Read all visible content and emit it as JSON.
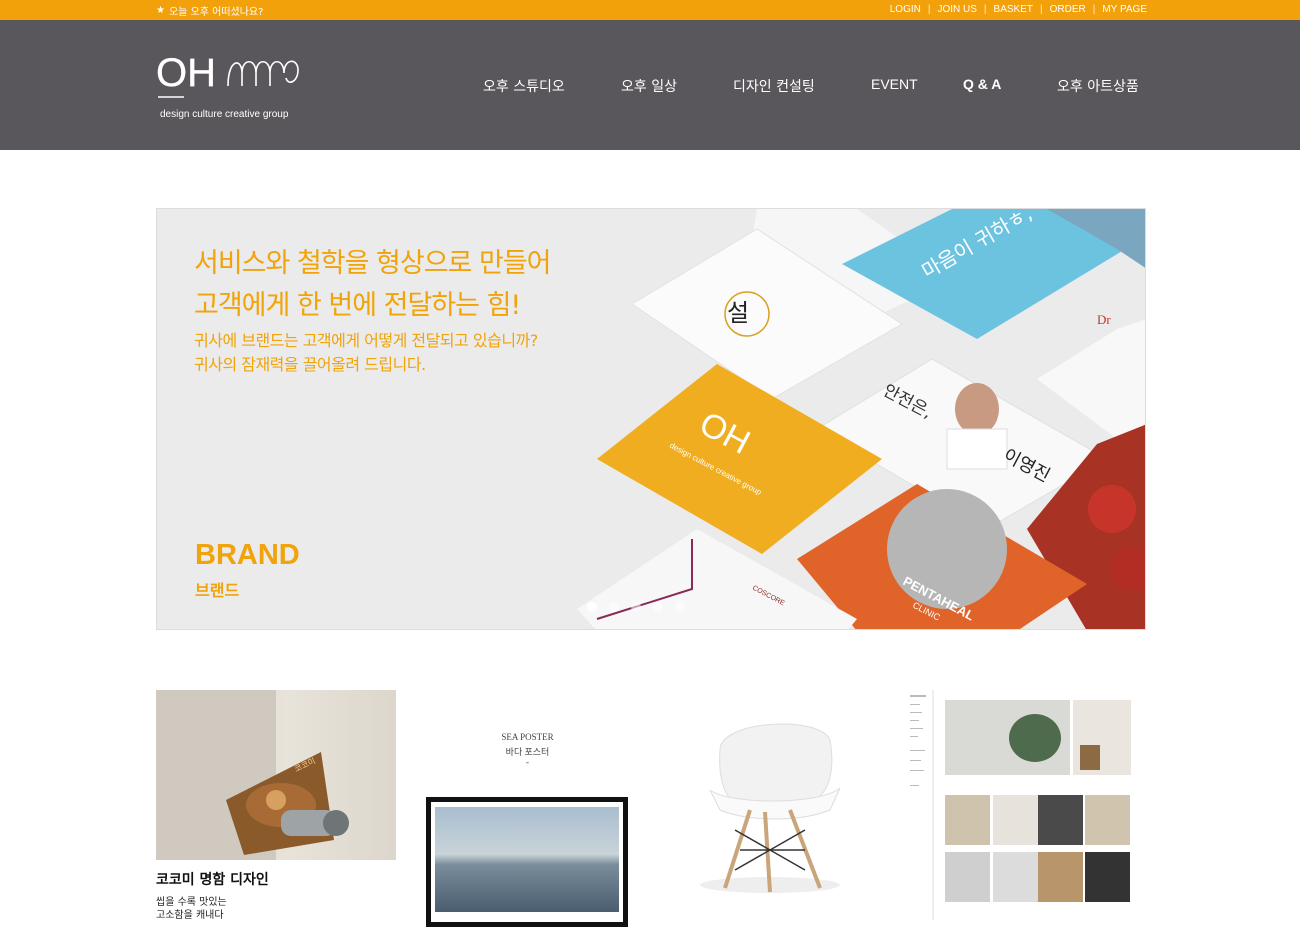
{
  "topbar": {
    "greeting": "오늘 오후 어떠셨나요?",
    "links": [
      "LOGIN",
      "JOIN US",
      "BASKET",
      "ORDER",
      "MY PAGE"
    ]
  },
  "logo": {
    "mark": "OH",
    "subtitle": "design culture creative group"
  },
  "nav": {
    "items": [
      "오후 스튜디오",
      "오후 일상",
      "디자인 컨설팅",
      "EVENT",
      "Q & A",
      "오후 아트상품"
    ]
  },
  "banner": {
    "headline_1": "서비스와 철학을 형상으로 만들어",
    "headline_2": "고객에게 한 번에 전달하는 힘!",
    "sub_1": "귀사에 브랜드는 고객에게 어떻게 전달되고 있습니까?",
    "sub_2": "귀사의 잠재력을 끌어올려 드립니다.",
    "category_en": "BRAND",
    "category_ko": "브랜드",
    "card_texts": {
      "logo_card_mark": "OH",
      "logo_card_sub": "design culture creative group",
      "name_card_top": "안전은,",
      "name_card_name": "이영진",
      "blue_card_text": "마음이 귀하ㅎ,",
      "pentaheal": "PENTAHEAL",
      "clinic": "CLINIC",
      "cosmos": "COSCORE"
    },
    "slides": {
      "count": 5,
      "active_index": 0
    },
    "colors": {
      "accent": "#f0a30a",
      "background": "#ebebeb"
    }
  },
  "gallery": {
    "items": [
      {
        "title": "코코미 명함 디자인",
        "desc": "씹을 수록 맛있는\n고소함을 캐내다"
      },
      {
        "caption_1": "SEA POSTER",
        "caption_2": "바다 포스터",
        "caption_3": "-"
      },
      {
        "alt": "white chair"
      },
      {
        "alt": "brand mockup sheet"
      }
    ]
  },
  "colors": {
    "topbar": "#f3a10b",
    "header": "#59575b"
  }
}
